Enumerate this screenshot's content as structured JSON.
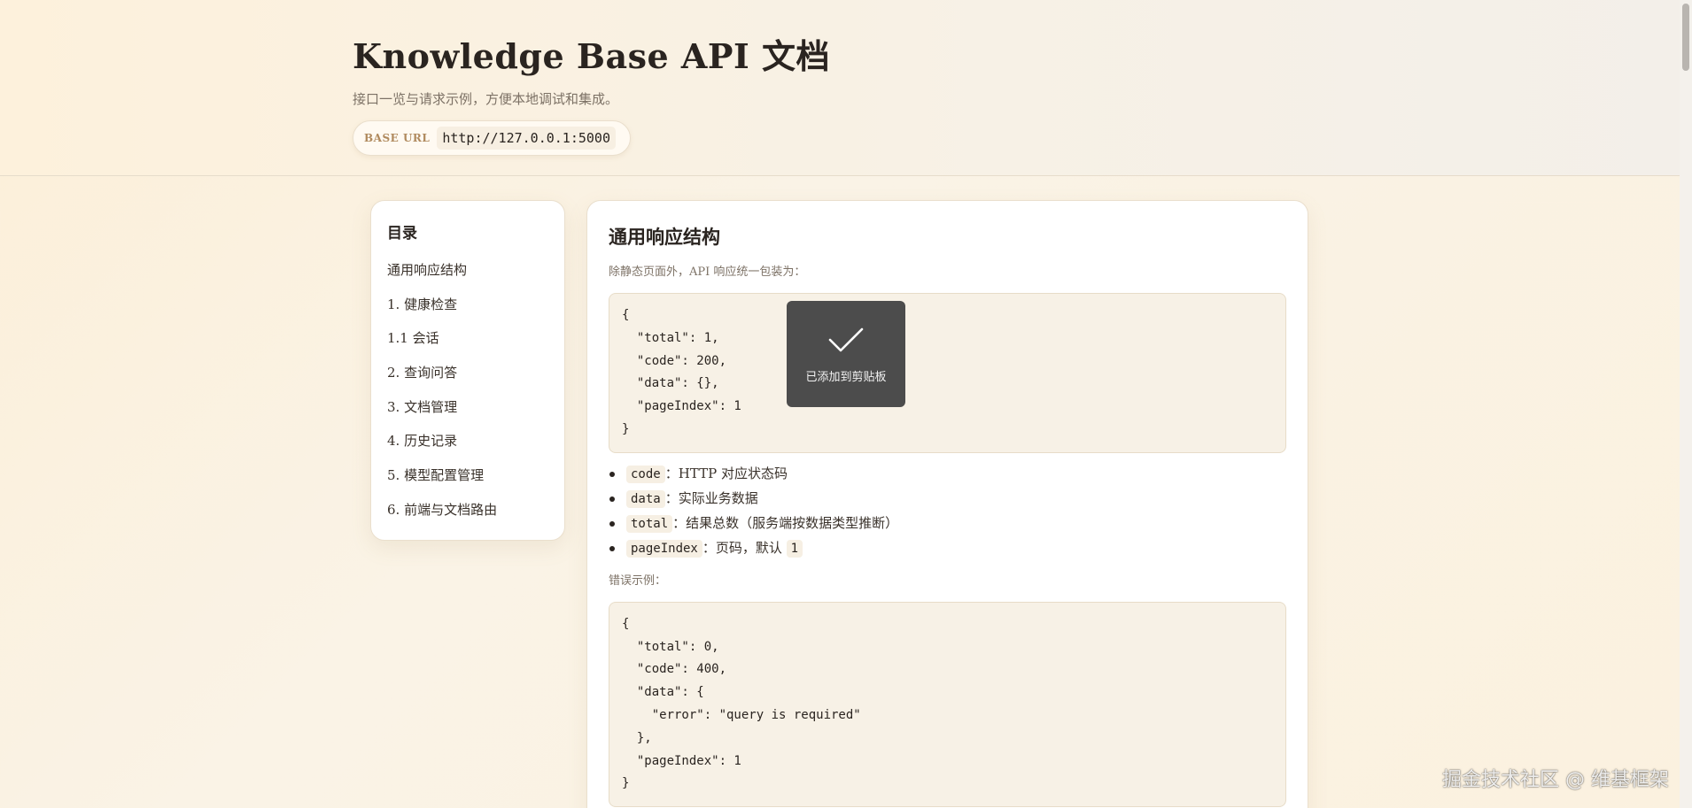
{
  "header": {
    "title": "Knowledge Base API 文档",
    "subtitle": "接口一览与请求示例，方便本地调试和集成。",
    "base_url_label": "BASE URL",
    "base_url_value": "http://127.0.0.1:5000"
  },
  "sidebar": {
    "title": "目录",
    "items": [
      {
        "label": "通用响应结构"
      },
      {
        "label": "1. 健康检查"
      },
      {
        "label": "1.1 会话"
      },
      {
        "label": "2. 查询问答"
      },
      {
        "label": "3. 文档管理"
      },
      {
        "label": "4. 历史记录"
      },
      {
        "label": "5. 模型配置管理"
      },
      {
        "label": "6. 前端与文档路由"
      }
    ]
  },
  "main": {
    "section_title": "通用响应结构",
    "section_desc": "除静态页面外，API 响应统一包装为：",
    "success_code": "{\n  \"total\": 1,\n  \"code\": 200,\n  \"data\": {},\n  \"pageIndex\": 1\n}",
    "fields": [
      {
        "name": "code",
        "desc": "：HTTP 对应状态码"
      },
      {
        "name": "data",
        "desc": "：实际业务数据"
      },
      {
        "name": "total",
        "desc": "：结果总数（服务端按数据类型推断）"
      },
      {
        "name": "pageIndex",
        "desc": "：页码，默认",
        "extra": "1"
      }
    ],
    "error_label": "错误示例：",
    "error_code": "{\n  \"total\": 0,\n  \"code\": 400,\n  \"data\": {\n    \"error\": \"query is required\"\n  },\n  \"pageIndex\": 1\n}"
  },
  "toast": {
    "icon": "check-icon",
    "text": "已添加到剪贴板"
  },
  "watermark": "掘金技术社区 @ 维基框架",
  "colors": {
    "background": "#fcefd8",
    "card": "#ffffff",
    "code_bg": "#f7f1e6",
    "toast_bg": "#4c4c4c",
    "label_accent": "#b08a5e"
  }
}
